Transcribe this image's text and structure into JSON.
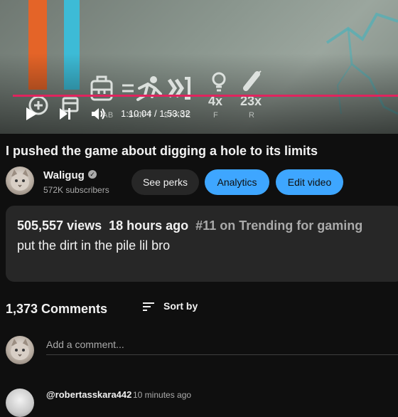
{
  "player": {
    "current_time": "1:10:04",
    "separator": " / ",
    "duration": "1:53:32",
    "progress_fraction": 1.0,
    "hud": {
      "key_ab": "AB",
      "key_shift": "SHIFT",
      "key_space": "SPACE",
      "key_f": "F",
      "key_r": "R",
      "count_4x": "4x",
      "count_23x": "23x"
    }
  },
  "video": {
    "title": "I pushed the game about digging a hole to its limits"
  },
  "channel": {
    "name": "Waligug",
    "subscribers": "572K subscribers"
  },
  "actions": {
    "see_perks": "See perks",
    "analytics": "Analytics",
    "edit_video": "Edit video"
  },
  "description": {
    "views": "505,557 views",
    "age": "18 hours ago",
    "trending": "#11 on Trending for gaming",
    "text": "put the dirt in the pile lil bro"
  },
  "comments": {
    "count": "1,373 Comments",
    "sort_label": "Sort by",
    "add_placeholder": "Add a comment...",
    "first": {
      "author": "@robertasskara442",
      "time": "10 minutes ago"
    }
  },
  "colors": {
    "accent_blue": "#3ea6ff",
    "progress_red": "#e0245e",
    "bg": "#0f0f0f"
  }
}
